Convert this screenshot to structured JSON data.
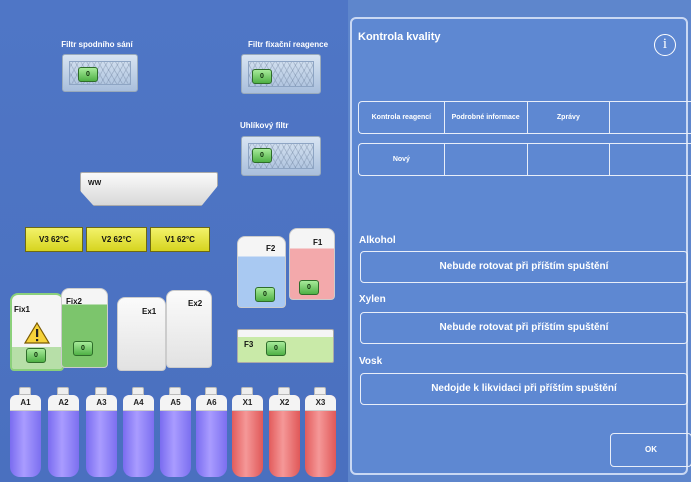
{
  "left": {
    "filters": {
      "bottom_suction_label": "Filtr spodního sání",
      "fixation_reagent_label": "Filtr fixační reagence",
      "carbon_label": "Uhlíkový filtr",
      "button_text": "0"
    },
    "waste_tray": "WW",
    "heaters": [
      "V3  62°C",
      "V2  62°C",
      "V1  62°C"
    ],
    "bottles": {
      "f2": "F2",
      "f1": "F1",
      "fix1": "Fix1",
      "fix2": "Fix2",
      "ex1": "Ex1",
      "ex2": "Ex2",
      "f3": "F3",
      "button_text": "0"
    },
    "tubes": [
      "A1",
      "A2",
      "A3",
      "A4",
      "A5",
      "A6",
      "X1",
      "X2",
      "X3"
    ]
  },
  "panel": {
    "title": "Kontrola kvality",
    "info_icon": "i",
    "tabs": [
      "Kontrola reagencí",
      "Podrobné informace",
      "Zprávy",
      ""
    ],
    "list_row": [
      "Nový",
      "",
      "",
      ""
    ],
    "alkohol": {
      "heading": "Alkohol",
      "status": "Nebude rotovat při příštím spuštění"
    },
    "xylen": {
      "heading": "Xylen",
      "status": "Nebude rotovat při příštím spuštění"
    },
    "vosk": {
      "heading": "Vosk",
      "status": "Nedojde k likvidaci při příštím spuštění"
    },
    "ok_label": "OK"
  },
  "colors": {
    "background": "#5e86cc",
    "heater": "#e8e73a",
    "tube_purple": "#8f82f5",
    "tube_red": "#ea7474",
    "button_green": "#6ccf5e"
  }
}
